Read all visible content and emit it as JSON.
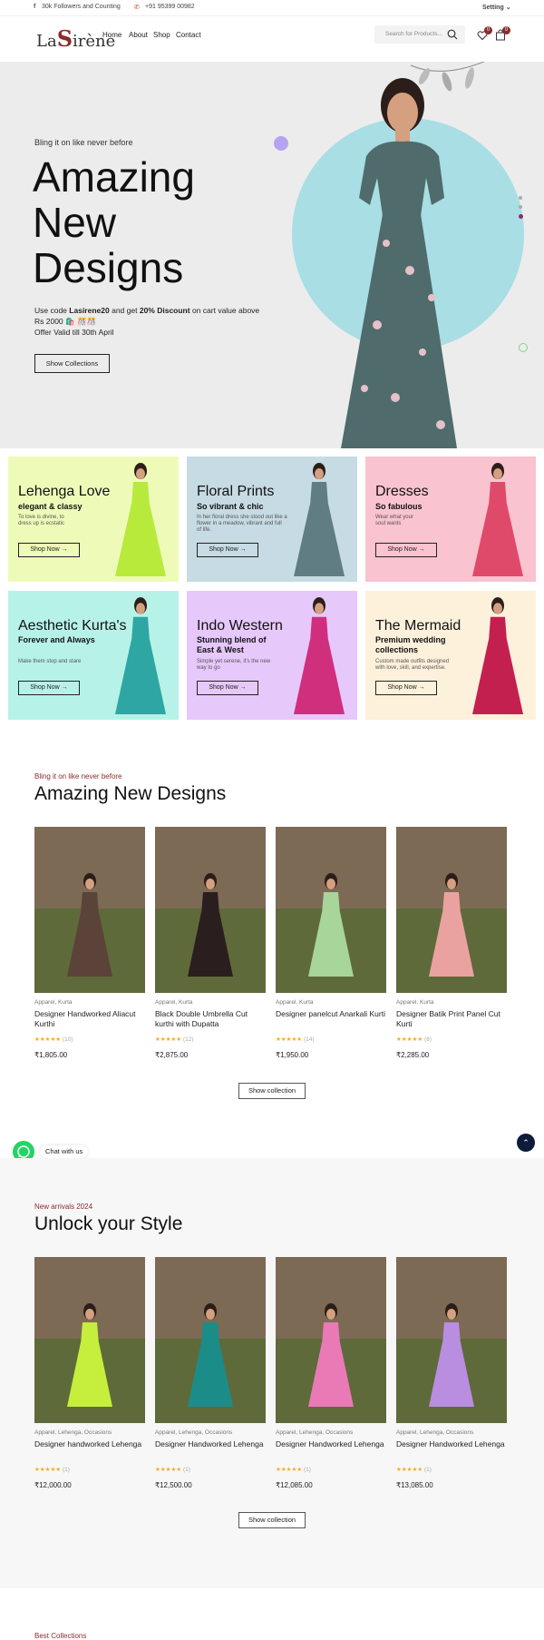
{
  "topbar": {
    "followers": "30k Followers and Counting",
    "phone": "+91 95399 00982",
    "setting": "Setting"
  },
  "nav": {
    "logo_a": "La",
    "logo_b": "S",
    "logo_c": "irène",
    "items": [
      "Home",
      "About",
      "Shop",
      "Contact"
    ],
    "search_placeholder": "Search for Products...",
    "wishlist_count": "0",
    "cart_count": "0"
  },
  "hero": {
    "kicker": "Bling it on like never before",
    "title_1": "Amazing",
    "title_2": "New",
    "title_3": "Designs",
    "copy_pre": "Use code",
    "code": "Lasirene20",
    "copy_mid": "and get",
    "discount": "20% Discount",
    "copy_post": "on cart value above Rs 2000 🛍️ 🎊🎊",
    "validity": "Offer Valid till 30th April",
    "button": "Show Collections"
  },
  "categories": [
    {
      "title": "Lehenga Love",
      "sub": "elegant & classy",
      "desc": "To love is divine, to dress up is ecstatic",
      "button": "Shop Now →",
      "bg": "#eefbb8"
    },
    {
      "title": "Floral Prints",
      "sub": "So vibrant & chic",
      "desc": "In her floral dress she stood out like a flower in a meadow, vibrant and full of life.",
      "button": "Shop Now →",
      "bg": "#c6dbe3"
    },
    {
      "title": "Dresses",
      "sub": "So fabulous",
      "desc": "Wear what your soul wants",
      "button": "Shop Now →",
      "bg": "#f9c3cf"
    },
    {
      "title": "Aesthetic Kurta's",
      "sub": "Forever and Always",
      "desc": "Make them stop and stare",
      "button": "Shop Now →",
      "bg": "#b7f2e8"
    },
    {
      "title": "Indo Western",
      "sub": "Stunning blend of East & West",
      "desc": "Simple yet serene, it's the new way to go",
      "button": "Shop Now →",
      "bg": "#e6c8fb"
    },
    {
      "title": "The Mermaid",
      "sub": "Premium wedding collections",
      "desc": "Custom made outfits designed with love, skill, and expertise.",
      "button": "Shop Now →",
      "bg": "#fdf1dc"
    }
  ],
  "section1": {
    "kicker": "Bling it on like never before",
    "heading": "Amazing New Designs",
    "show": "Show collection",
    "products": [
      {
        "cat": "Apparel, Kurta",
        "name": "Designer Handworked Aliacut Kurthi",
        "stars": "★★★★★",
        "reviews": "(10)",
        "price": "₹1,805.00",
        "color": "#5b4339"
      },
      {
        "cat": "Apparel, Kurta",
        "name": "Black Double Umbrella Cut kurthi with Dupatta",
        "stars": "★★★★★",
        "reviews": "(12)",
        "price": "₹2,875.00",
        "color": "#2a1f1e"
      },
      {
        "cat": "Apparel, Kurta",
        "name": "Designer panelcut Anarkali Kurti",
        "stars": "★★★★★",
        "reviews": "(14)",
        "price": "₹1,950.00",
        "color": "#a7d59a"
      },
      {
        "cat": "Apparel, Kurta",
        "name": "Designer Batik Print Panel Cut Kurti",
        "stars": "★★★★★",
        "reviews": "(8)",
        "price": "₹2,285.00",
        "color": "#eaa2a0"
      }
    ]
  },
  "chat": {
    "label": "Chat with us"
  },
  "section2": {
    "kicker": "New arrivals 2024",
    "heading": "Unlock your Style",
    "show": "Show collection",
    "products": [
      {
        "cat": "Apparel, Lehenga, Occasions",
        "name": "Designer handworked Lehenga",
        "stars": "★★★★★",
        "reviews": "(1)",
        "price": "₹12,000.00",
        "color": "#c5ef3c"
      },
      {
        "cat": "Apparel, Lehenga, Occasions",
        "name": "Designer Handworked Lehenga",
        "stars": "★★★★★",
        "reviews": "(1)",
        "price": "₹12,500.00",
        "color": "#1c8c89"
      },
      {
        "cat": "Apparel, Lehenga, Occasions",
        "name": "Designer Handworked Lehenga",
        "stars": "★★★★★",
        "reviews": "(1)",
        "price": "₹12,085.00",
        "color": "#ea7ab6"
      },
      {
        "cat": "Apparel, Lehenga, Occasions",
        "name": "Designer Handworked Lehenga",
        "stars": "★★★★★",
        "reviews": "(1)",
        "price": "₹13,085.00",
        "color": "#b98ee0"
      }
    ]
  },
  "section3": {
    "kicker": "Best Collections"
  }
}
